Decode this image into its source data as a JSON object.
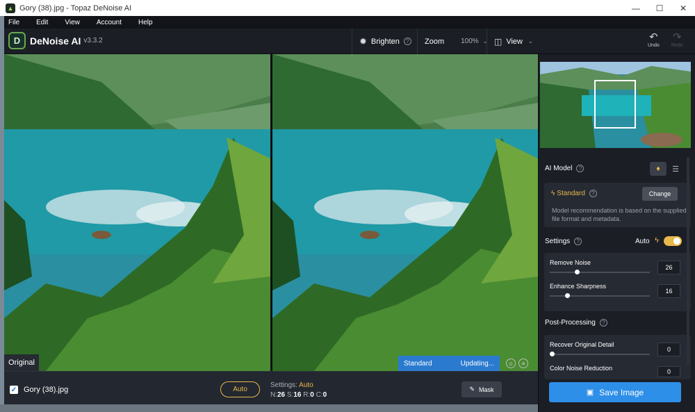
{
  "window": {
    "title": "Gory (38).jpg - Topaz DeNoise AI",
    "minimize": "—",
    "maximize": "☐",
    "close": "✕"
  },
  "menu": [
    "File",
    "Edit",
    "View",
    "Account",
    "Help"
  ],
  "app": {
    "name": "DeNoise AI",
    "version": "v3.3.2",
    "logo_letter": "D"
  },
  "toolbar": {
    "brighten": "Brighten",
    "zoom_label": "Zoom",
    "zoom_value": "100%",
    "view": "View",
    "undo": "Undo",
    "redo": "Redo"
  },
  "viewer": {
    "original_label": "Original",
    "status_model": "Standard",
    "status_state": "Updating..."
  },
  "bottom": {
    "filename": "Gory (38).jpg",
    "auto_button": "Auto",
    "settings_label": "Settings:",
    "settings_mode": "Auto",
    "n_label": "N:",
    "n": "26",
    "s_label": "S:",
    "s": "16",
    "r_label": "R:",
    "r": "0",
    "c_label": "C:",
    "c": "0",
    "mask_button": "Mask"
  },
  "sidebar": {
    "ai_model_title": "AI Model",
    "model_name": "Standard",
    "change_button": "Change",
    "recommendation": "Model recommendation is based on the supplied file format and metadata.",
    "settings_title": "Settings",
    "auto_label": "Auto",
    "auto_enabled": true,
    "remove_noise_label": "Remove Noise",
    "remove_noise_value": "26",
    "enhance_sharpness_label": "Enhance Sharpness",
    "enhance_sharpness_value": "16",
    "post_processing_title": "Post-Processing",
    "recover_detail_label": "Recover Original Detail",
    "recover_detail_value": "0",
    "color_noise_label": "Color Noise Reduction",
    "color_noise_value": "0",
    "save_button": "Save Image"
  },
  "colors": {
    "accent": "#e8b84a",
    "primary": "#2e8fe8",
    "bg": "#1b1e25"
  }
}
